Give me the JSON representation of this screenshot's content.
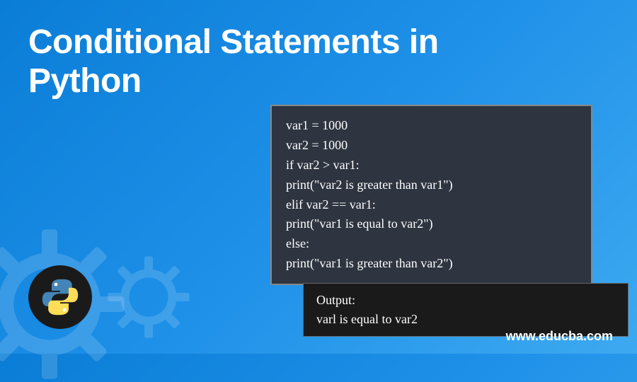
{
  "title_line1": "Conditional Statements in",
  "title_line2": "Python",
  "code": {
    "line1": "var1 = 1000",
    "line2": "var2 = 1000",
    "line3": "if var2 > var1:",
    "line4": "print(\"var2 is greater than var1\")",
    "line5": "elif var2 == var1:",
    "line6": "print(\"var1 is equal to var2\")",
    "line7": "else:",
    "line8": "print(\"var1 is greater than var2\")"
  },
  "output": {
    "label": "Output:",
    "text": "varl is equal to var2"
  },
  "website": "www.educba.com"
}
